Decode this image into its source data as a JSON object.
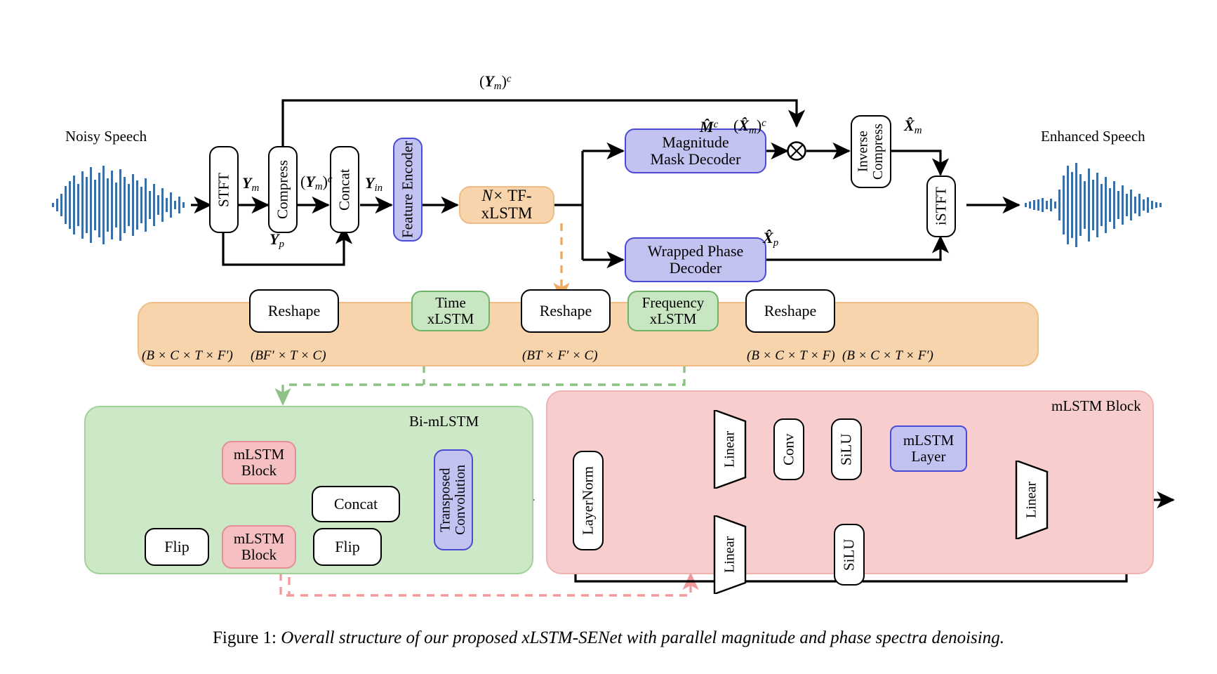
{
  "figure": {
    "caption_prefix": "Figure 1:",
    "caption_text": "Overall structure of our proposed xLSTM-SENet with parallel magnitude and phase spectra denoising."
  },
  "colors": {
    "orange_fill": "#f7d4ab",
    "orange_stroke": "#f0bc85",
    "green_fill": "#cde8c6",
    "green_stroke": "#9fd199",
    "pink_fill": "#f7cecd",
    "pink_stroke": "#f0b3b2",
    "purple_fill": "#c3c3f2",
    "purple_stroke": "#4a4ad6",
    "node_green_fill": "#c8e6c2",
    "node_pink_fill": "#f6bfc2",
    "waveform_blue": "#3a6ea5",
    "line_black": "#000000"
  },
  "top_pipeline": {
    "input_label": "Noisy Speech",
    "output_label": "Enhanced Speech",
    "nodes": {
      "stft": "STFT",
      "compress": "Compress",
      "concat": "Concat",
      "feature_encoder": "Feature Encoder",
      "tf_xlstm": "TF-xLSTM",
      "tf_xlstm_prefix": "N×",
      "magnitude_mask_decoder_line1": "Magnitude",
      "magnitude_mask_decoder_line2": "Mask Decoder",
      "wrapped_phase_decoder_line1": "Wrapped Phase",
      "wrapped_phase_decoder_line2": "Decoder",
      "inverse_compress_line1": "Inverse",
      "inverse_compress_line2": "Compress",
      "istft": "iSTFT"
    },
    "signal_labels": {
      "y_m": "Y_m",
      "y_m_c": "(Y_m)^c",
      "y_m_c_skip": "(Y_m)^c",
      "y_p": "Y_p",
      "y_in": "Y_in",
      "m_hat_c": "M̂^c",
      "x_hat_m_c": "(X̂_m)^c",
      "x_hat_m": "X̂_m",
      "x_hat_p": "X̂_p"
    },
    "operators": {
      "multiply": "⊗"
    }
  },
  "tf_xlstm_band": {
    "title": "",
    "nodes": {
      "reshape1": "Reshape",
      "time_xlstm_line1": "Time",
      "time_xlstm_line2": "xLSTM",
      "reshape2": "Reshape",
      "frequency_xlstm_line1": "Frequency",
      "frequency_xlstm_line2": "xLSTM",
      "reshape3": "Reshape"
    },
    "shapes": {
      "input": "(B × C × T × F′)",
      "after_reshape1": "(BF′ × T × C)",
      "after_reshape2": "(BT × F′ × C)",
      "after_reshape3": "(B × C × T × F)",
      "output": "(B × C × T × F′)"
    },
    "operators": {
      "add": "⊕"
    }
  },
  "bi_mlstm": {
    "title": "Bi-mLSTM",
    "nodes": {
      "mlstm_block_top_line1": "mLSTM",
      "mlstm_block_top_line2": "Block",
      "mlstm_block_bottom_line1": "mLSTM",
      "mlstm_block_bottom_line2": "Block",
      "flip_in": "Flip",
      "flip_out": "Flip",
      "concat": "Concat",
      "transposed_convolution_line1": "Transposed",
      "transposed_convolution_line2": "Convolution"
    }
  },
  "mlstm_block": {
    "title": "mLSTM Block",
    "nodes": {
      "layernorm": "LayerNorm",
      "linear_top": "Linear",
      "conv": "Conv",
      "silu_top": "SiLU",
      "mlstm_layer_line1": "mLSTM",
      "mlstm_layer_line2": "Layer",
      "linear_bottom": "Linear",
      "silu_bottom": "SiLU",
      "linear_out": "Linear"
    },
    "operators": {
      "multiply": "⊗",
      "add": "⊕"
    }
  }
}
